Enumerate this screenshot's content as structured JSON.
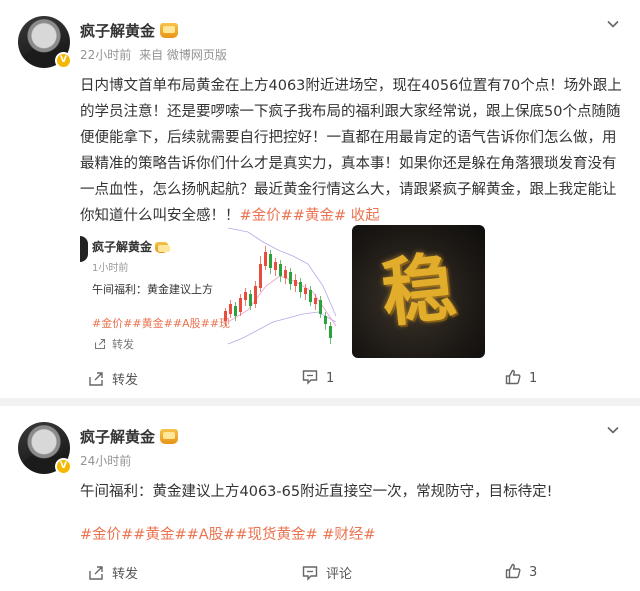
{
  "posts": [
    {
      "username": "疯子解黄金",
      "time": "22小时前",
      "source": "来自 微博网页版",
      "text": "日内博文首单布局黄金在上方4063附近进场空，现在4056位置有70个点！场外跟上的学员注意！还是要啰嗦一下疯子我布局的福利跟大家经常说，跟上保底50个点随随便便能拿下，后续就需要自行把控好！一直都在用最肯定的语气告诉你们怎么做，用最精准的策略告诉你们什么才是真实力，真本事！如果你还是躲在角落猥琐发育没有一点血性，怎么扬帆起航？最近黄金行情这么大，请跟紧疯子解黄金，跟上我定能让你知道什么叫安全感！！",
      "tags": "#金价##黄金#",
      "collapse": "收起",
      "repost_card": {
        "username": "疯子解黄金",
        "time": "1小时前",
        "text": "午间福利：黄金建议上方",
        "tags": "#金价##黄金##A股##现",
        "repost_label": "转发"
      },
      "image_glyph": "稳",
      "actions": {
        "repost": "转发",
        "comment": "1",
        "like": "1"
      }
    },
    {
      "username": "疯子解黄金",
      "time": "24小时前",
      "text": "午间福利：黄金建议上方4063-65附近直接空一次，常规防守，目标待定!",
      "tags": "#金价##黄金##A股##现货黄金# #财经#",
      "actions": {
        "repost": "转发",
        "comment": "评论",
        "like": "3"
      }
    }
  ],
  "colors": {
    "accent": "#eb7350",
    "verified": "#f5b800",
    "candle_up": "#e94b3c",
    "candle_down": "#2aa33a"
  }
}
